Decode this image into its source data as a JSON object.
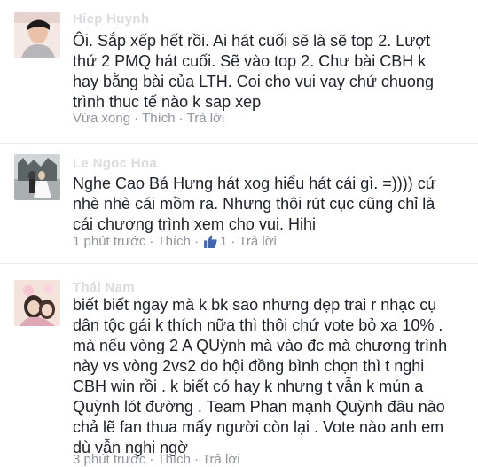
{
  "comments": [
    {
      "author": "Hiep Huynh",
      "lines": [
        "Ôi. Sắp xếp hết rồi. Ai hát cuối sẽ là sẽ top 2. Lượt",
        "thứ 2 PMQ hát cuối. Sẽ vào top 2. Chư bài CBH k",
        "hay bằng bài của LTH. Coi cho vui vay chứ chuong",
        "trình thuc tế nào k sap xep"
      ],
      "time": "Vừa xong",
      "like_label": "Thích",
      "reply_label": "Trả lời"
    },
    {
      "author": "Le Ngoc Hoa",
      "lines": [
        "Nghe Cao Bá Hưng hát xog    hiểu hát cái gì. =)))) cứ",
        "nhè nhè cái mồm ra. Nhưng thôi rút cục cũng chỉ là",
        "cái chương trình xem cho vui. Hihi"
      ],
      "time": "1 phút trước",
      "like_label": "Thích",
      "like_count": "1",
      "reply_label": "Trả lời"
    },
    {
      "author": "Thái Nam",
      "lines": [
        "biết  biết ngay mà k bk sao nhưng đẹp trai r nhạc cụ",
        "dân tộc gái k thích nữa thì thôi chứ vote bỏ xa 10% .",
        " mà nếu vòng 2 A QUỳnh mà vào đc mà chương trình",
        "này vs vòng 2vs2 do hội đồng bình chọn thì t nghi",
        "CBH win rồi . k biết có hay k nhưng t vẫn k mún a",
        "Quỳnh lót đường . Team Phan mạnh Quỳnh đâu nào",
        "chả lẽ  fan thua mấy người còn lại . Vote nào anh em",
        "dù vẫn nghi ngờ"
      ],
      "time": "3 phút trước",
      "like_label": "Thích",
      "reply_label": "Trả lời"
    }
  ],
  "colors": {
    "text": "#1d2129",
    "meta": "#90949c",
    "like_blue": "#4267b2"
  },
  "icons": [
    "like-thumb-icon"
  ]
}
